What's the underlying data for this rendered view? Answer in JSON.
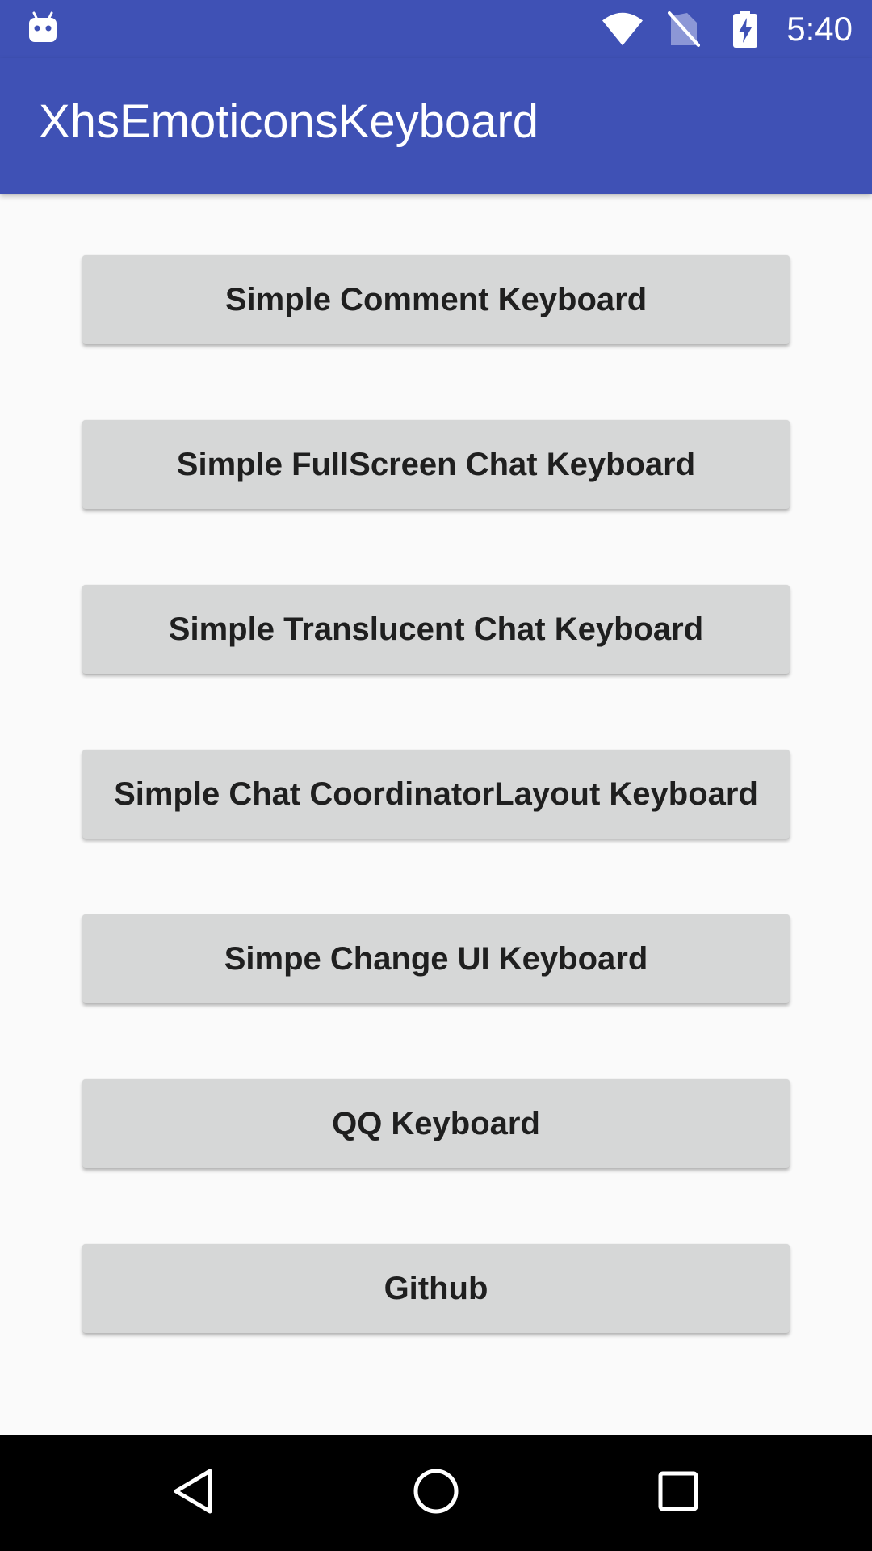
{
  "status_bar": {
    "time": "5:40",
    "icons": [
      "android-notification-icon",
      "wifi-icon",
      "no-sim-icon",
      "battery-charging-icon"
    ]
  },
  "app_bar": {
    "title": "XhsEmoticonsKeyboard",
    "background_color": "#3f51b5"
  },
  "buttons": [
    {
      "label": "Simple Comment Keyboard"
    },
    {
      "label": "Simple FullScreen Chat Keyboard"
    },
    {
      "label": "Simple Translucent Chat Keyboard"
    },
    {
      "label": "Simple Chat CoordinatorLayout Keyboard"
    },
    {
      "label": "Simpe Change UI Keyboard"
    },
    {
      "label": "QQ Keyboard"
    },
    {
      "label": "Github"
    }
  ],
  "nav_bar": {
    "icons": [
      "back-icon",
      "home-icon",
      "recents-icon"
    ]
  }
}
